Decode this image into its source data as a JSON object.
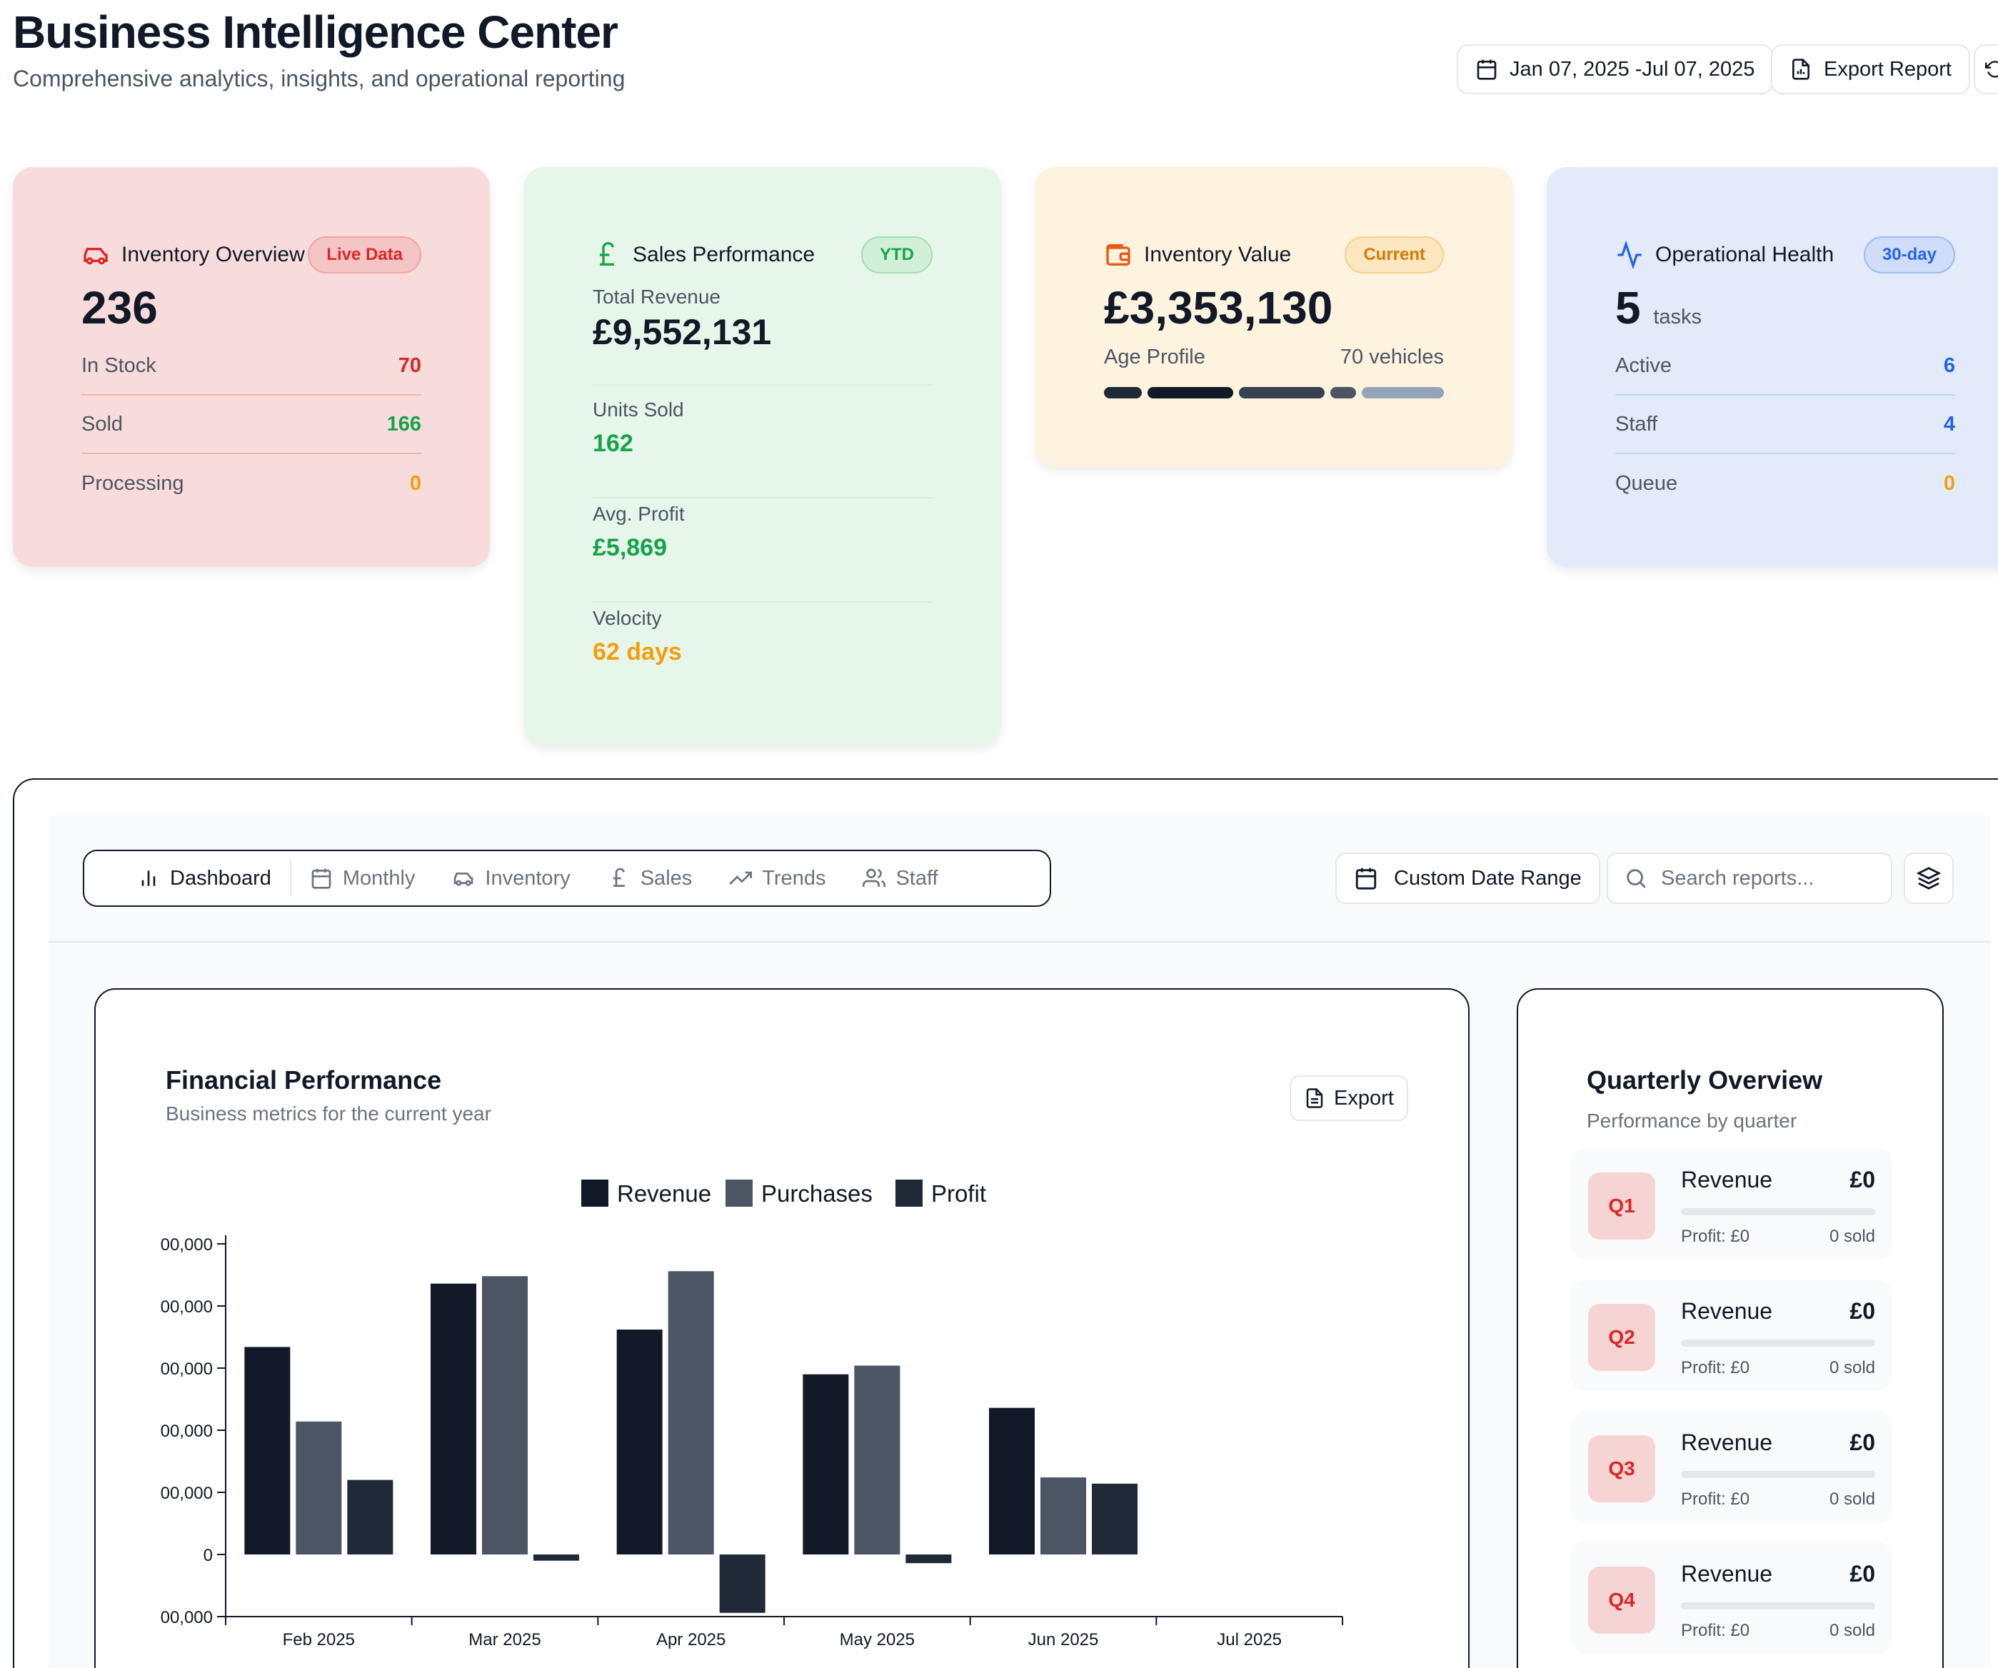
{
  "header": {
    "title": "Business Intelligence Center",
    "subtitle": "Comprehensive analytics, insights, and operational reporting",
    "date_range": "Jan 07, 2025 -Jul 07, 2025",
    "export_label": "Export Report"
  },
  "kpis": {
    "inventory": {
      "title": "Inventory Overview",
      "badge": "Live Data",
      "value": "236",
      "rows": [
        {
          "label": "In Stock",
          "value": "70"
        },
        {
          "label": "Sold",
          "value": "166"
        },
        {
          "label": "Processing",
          "value": "0"
        }
      ]
    },
    "sales": {
      "title": "Sales Performance",
      "badge": "YTD",
      "items": [
        {
          "label": "Total Revenue",
          "value": "£9,552,131"
        },
        {
          "label": "Units Sold",
          "value": "162"
        },
        {
          "label": "Avg. Profit",
          "value": "£5,869"
        },
        {
          "label": "Velocity",
          "value": "62 days"
        }
      ]
    },
    "value": {
      "title": "Inventory Value",
      "badge": "Current",
      "value": "£3,353,130",
      "age_label": "Age Profile",
      "age_count": "70 vehicles",
      "age_segments": [
        {
          "share": 0.12,
          "color": "#1f2937"
        },
        {
          "share": 0.27,
          "color": "#111827"
        },
        {
          "share": 0.27,
          "color": "#374151"
        },
        {
          "share": 0.08,
          "color": "#4b5563"
        },
        {
          "share": 0.26,
          "color": "#94a3b8"
        }
      ]
    },
    "health": {
      "title": "Operational Health",
      "badge": "30-day",
      "value": "5",
      "unit": "tasks",
      "rows": [
        {
          "label": "Active",
          "value": "6"
        },
        {
          "label": "Staff",
          "value": "4"
        },
        {
          "label": "Queue",
          "value": "0"
        }
      ]
    }
  },
  "tabs": [
    {
      "label": "Dashboard",
      "icon": "bar-chart-icon"
    },
    {
      "label": "Monthly",
      "icon": "calendar-icon"
    },
    {
      "label": "Inventory",
      "icon": "car-icon"
    },
    {
      "label": "Sales",
      "icon": "pound-icon"
    },
    {
      "label": "Trends",
      "icon": "trending-up-icon"
    },
    {
      "label": "Staff",
      "icon": "users-icon"
    }
  ],
  "toolbar": {
    "custom_range": "Custom Date Range",
    "search_placeholder": "Search reports..."
  },
  "financial": {
    "title": "Financial Performance",
    "subtitle": "Business metrics for the current year",
    "export_label": "Export"
  },
  "chart_data": {
    "type": "bar",
    "categories": [
      "Feb 2025",
      "Mar 2025",
      "Apr 2025",
      "May 2025",
      "Jun 2025",
      "Jul 2025"
    ],
    "series": [
      {
        "name": "Revenue",
        "color": "#111827",
        "values": [
          1670000,
          2180000,
          1810000,
          1450000,
          1180000,
          0
        ]
      },
      {
        "name": "Purchases",
        "color": "#4b5563",
        "values": [
          1070000,
          2240000,
          2280000,
          1520000,
          620000,
          0
        ]
      },
      {
        "name": "Profit",
        "color": "#1f2937",
        "values": [
          600000,
          -50000,
          -470000,
          -70000,
          570000,
          0
        ]
      }
    ],
    "y_ticks": [
      "00,000",
      "00,000",
      "00,000",
      "00,000",
      "00,000",
      "0",
      "00,000"
    ],
    "ylim": [
      -500000,
      2500000
    ],
    "legend": "top-center",
    "grid": false
  },
  "quarterly": {
    "title": "Quarterly Overview",
    "subtitle": "Performance by quarter",
    "items": [
      {
        "q": "Q1",
        "label": "Revenue",
        "amount": "£0",
        "profit": "Profit: £0",
        "sold": "0 sold",
        "progress": 0
      },
      {
        "q": "Q2",
        "label": "Revenue",
        "amount": "£0",
        "profit": "Profit: £0",
        "sold": "0 sold",
        "progress": 0
      },
      {
        "q": "Q3",
        "label": "Revenue",
        "amount": "£0",
        "profit": "Profit: £0",
        "sold": "0 sold",
        "progress": 0
      },
      {
        "q": "Q4",
        "label": "Revenue",
        "amount": "£0",
        "profit": "Profit: £0",
        "sold": "0 sold",
        "progress": 0
      }
    ]
  }
}
